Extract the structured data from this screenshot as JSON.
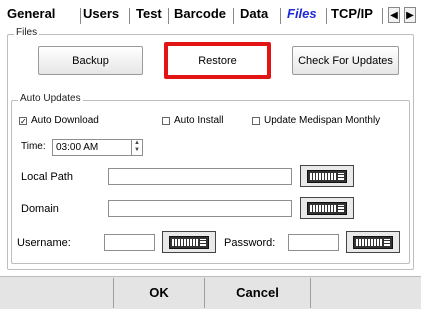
{
  "tabs": [
    "General",
    "Users",
    "Test",
    "Barcode",
    "Data",
    "Files",
    "TCP/IP"
  ],
  "active_tab": "Files",
  "files_group": {
    "title": "Files",
    "backup_label": "Backup",
    "restore_label": "Restore",
    "check_updates_label": "Check For Updates"
  },
  "auto_updates": {
    "title": "Auto Updates",
    "auto_download_label": "Auto Download",
    "auto_download_checked": true,
    "auto_install_label": "Auto Install",
    "auto_install_checked": false,
    "medispan_label": "Update Medispan Monthly",
    "medispan_checked": false,
    "time_label": "Time:",
    "time_value": "03:00 AM",
    "local_path_label": "Local Path",
    "local_path_value": "",
    "domain_label": "Domain",
    "domain_value": "",
    "username_label": "Username:",
    "username_value": "",
    "password_label": "Password:",
    "password_value": ""
  },
  "bottom": {
    "ok_label": "OK",
    "cancel_label": "Cancel"
  },
  "icons": {
    "check_mark": "✓",
    "arrow_left": "◀",
    "arrow_right": "▶",
    "spin_up": "▲",
    "spin_down": "▼"
  }
}
